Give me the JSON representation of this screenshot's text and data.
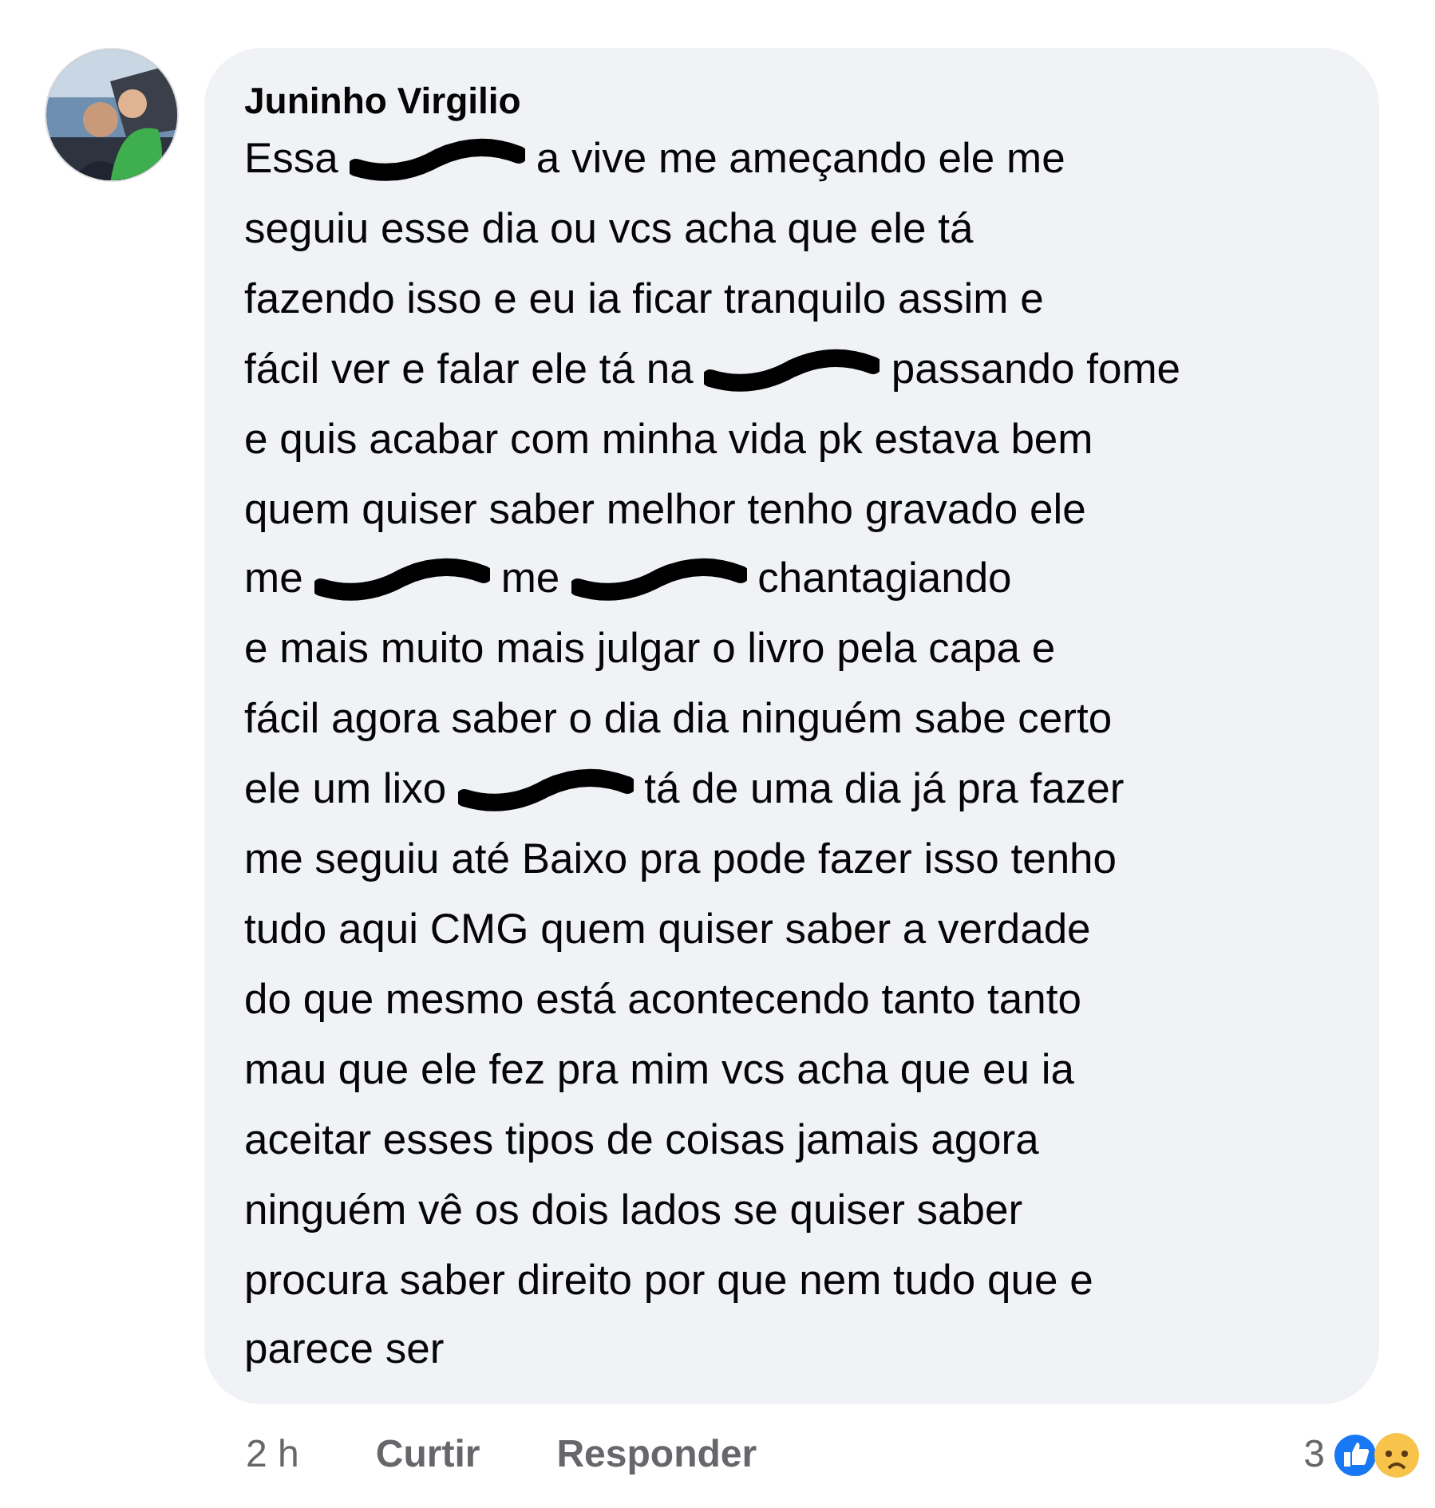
{
  "comment": {
    "author": "Juninho Virgilio",
    "avatar": {
      "kind": "picture"
    },
    "lines": [
      [
        {
          "kind": "text",
          "text": "Essa"
        },
        {
          "kind": "redaction"
        },
        {
          "kind": "text",
          "text": "a vive me ameçando ele me"
        }
      ],
      [
        {
          "kind": "text",
          "text": "seguiu esse dia ou vcs acha que ele tá"
        }
      ],
      [
        {
          "kind": "text",
          "text": "fazendo isso e eu ia ficar tranquilo assim e"
        }
      ],
      [
        {
          "kind": "text",
          "text": "fácil ver e falar ele tá na"
        },
        {
          "kind": "redaction"
        },
        {
          "kind": "text",
          "text": "passando fome"
        }
      ],
      [
        {
          "kind": "text",
          "text": "e quis acabar com minha vida pk estava bem"
        }
      ],
      [
        {
          "kind": "text",
          "text": "quem quiser saber melhor tenho gravado ele"
        }
      ],
      [
        {
          "kind": "text",
          "text": "me"
        },
        {
          "kind": "redaction"
        },
        {
          "kind": "text",
          "text": "me"
        },
        {
          "kind": "redaction"
        },
        {
          "kind": "text",
          "text": "chantagiando"
        }
      ],
      [
        {
          "kind": "text",
          "text": "e mais muito mais julgar o livro pela capa e"
        }
      ],
      [
        {
          "kind": "text",
          "text": "fácil agora saber o dia dia ninguém sabe certo"
        }
      ],
      [
        {
          "kind": "text",
          "text": "ele um lixo"
        },
        {
          "kind": "redaction"
        },
        {
          "kind": "text",
          "text": "tá de uma dia já pra fazer"
        }
      ],
      [
        {
          "kind": "text",
          "text": "me seguiu até Baixo pra pode fazer isso tenho"
        }
      ],
      [
        {
          "kind": "text",
          "text": "tudo aqui CMG quem quiser saber a verdade"
        }
      ],
      [
        {
          "kind": "text",
          "text": "do que mesmo está acontecendo tanto tanto"
        }
      ],
      [
        {
          "kind": "text",
          "text": "mau que ele fez pra mim vcs acha que eu ia"
        }
      ],
      [
        {
          "kind": "text",
          "text": "aceitar esses tipos de coisas jamais agora"
        }
      ],
      [
        {
          "kind": "text",
          "text": "ninguém vê os dois lados se quiser saber"
        }
      ],
      [
        {
          "kind": "text",
          "text": "procura saber direito por que nem tudo que e"
        }
      ],
      [
        {
          "kind": "text",
          "text": "parece ser"
        }
      ]
    ],
    "time": "2 h",
    "actions": [
      "Curtir",
      "Responder"
    ],
    "reactions": {
      "count": "3",
      "icons": [
        {
          "kind": "like"
        },
        {
          "kind": "sad"
        }
      ]
    }
  }
}
